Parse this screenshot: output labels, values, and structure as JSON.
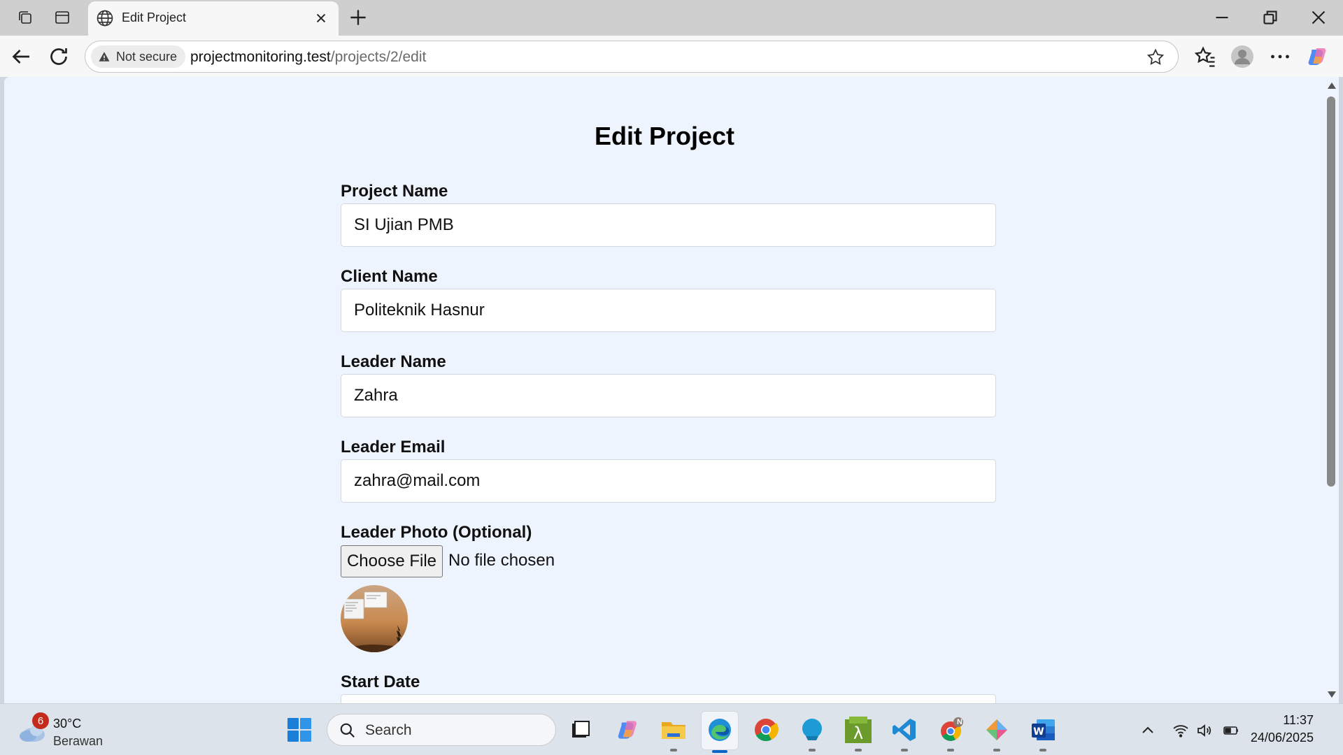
{
  "browser": {
    "tab_title": "Edit Project",
    "security_label": "Not secure",
    "url_host": "projectmonitoring.test",
    "url_path": "/projects/2/edit"
  },
  "page": {
    "title": "Edit Project",
    "fields": {
      "project_name": {
        "label": "Project Name",
        "value": "SI Ujian PMB"
      },
      "client_name": {
        "label": "Client Name",
        "value": "Politeknik Hasnur"
      },
      "leader_name": {
        "label": "Leader Name",
        "value": "Zahra"
      },
      "leader_email": {
        "label": "Leader Email",
        "value": "zahra@mail.com"
      },
      "leader_photo": {
        "label": "Leader Photo (Optional)",
        "button": "Choose File",
        "status": "No file chosen"
      },
      "start_date": {
        "label": "Start Date"
      }
    }
  },
  "taskbar": {
    "weather_badge": "6",
    "weather_temp": "30°C",
    "weather_desc": "Berawan",
    "search_placeholder": "Search",
    "chrome_profile_badge": "N",
    "time": "11:37",
    "date": "24/06/2025"
  },
  "colors": {
    "page_background": "#edf4fd",
    "accent": "#0a64c8"
  }
}
